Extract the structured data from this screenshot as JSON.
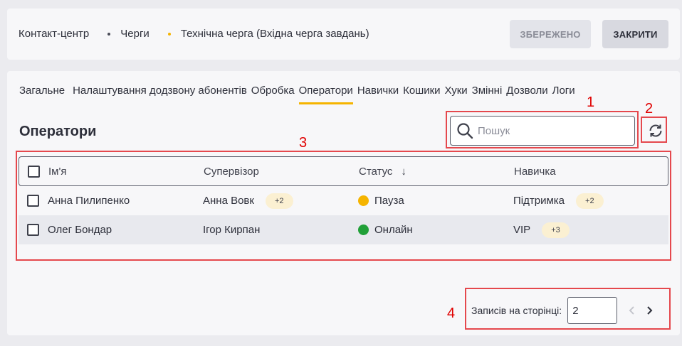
{
  "breadcrumbs": [
    "Контакт-центр",
    "Черги",
    "Технічна черга (Вхідна черга завдань)"
  ],
  "colors": {
    "accent": "#f5b400",
    "pause": "#f5b400",
    "online": "#21a038",
    "annotation": "#e5484d"
  },
  "header": {
    "saved_label": "ЗБЕРЕЖЕНО",
    "close_label": "ЗАКРИТИ"
  },
  "tabs": [
    {
      "label": "Загальне",
      "active": false
    },
    {
      "label": "Налаштування додзвону абонентів",
      "active": false
    },
    {
      "label": "Обробка",
      "active": false
    },
    {
      "label": "Оператори",
      "active": true
    },
    {
      "label": "Навички",
      "active": false
    },
    {
      "label": "Кошики",
      "active": false
    },
    {
      "label": "Хуки",
      "active": false
    },
    {
      "label": "Змінні",
      "active": false
    },
    {
      "label": "Дозволи",
      "active": false
    },
    {
      "label": "Логи",
      "active": false
    }
  ],
  "section_title": "Оператори",
  "search": {
    "placeholder": "Пошук",
    "icon": "search-icon"
  },
  "refresh": {
    "icon": "refresh-icon"
  },
  "table": {
    "columns": [
      "Ім'я",
      "Супервізор",
      "Статус",
      "Навичка"
    ],
    "sort_indicator": "↓",
    "rows": [
      {
        "name": "Анна Пилипенко",
        "supervisor": "Анна Вовк",
        "supervisor_extra": "+2",
        "status": "Пауза",
        "status_color": "#f5b400",
        "skill": "Підтримка",
        "skill_extra": "+2"
      },
      {
        "name": "Олег Бондар",
        "supervisor": "Ігор Кирпан",
        "supervisor_extra": "",
        "status": "Онлайн",
        "status_color": "#21a038",
        "skill": "VIP",
        "skill_extra": "+3"
      }
    ]
  },
  "pager": {
    "label": "Записів на сторінці:",
    "value": "2"
  },
  "annotations": [
    "1",
    "2",
    "3",
    "4"
  ]
}
